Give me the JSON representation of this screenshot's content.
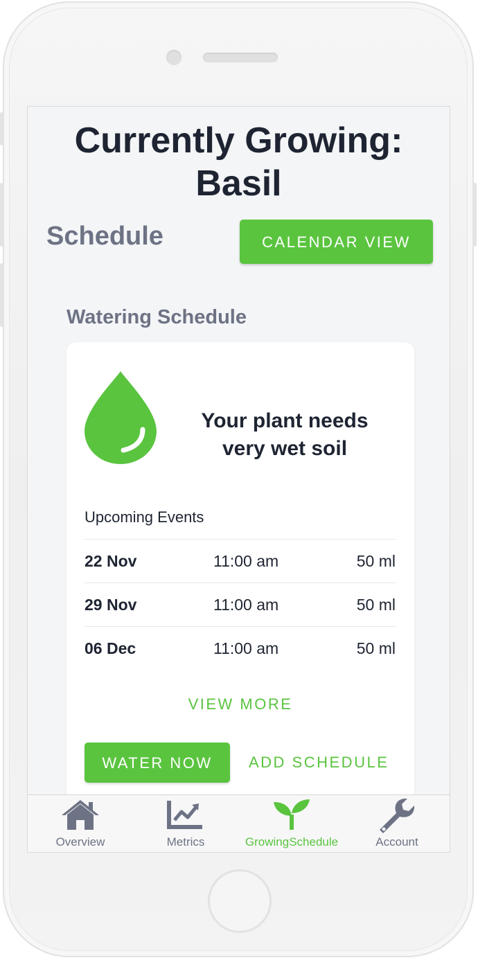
{
  "header": {
    "title_line1": "Currently Growing:",
    "title_line2": "Basil"
  },
  "schedule": {
    "section_title": "Schedule",
    "calendar_button": "CALENDAR VIEW"
  },
  "watering": {
    "title": "Watering Schedule",
    "icon": "water-drop-icon",
    "need_line1": "Your plant needs",
    "need_line2": "very wet soil",
    "events_heading": "Upcoming Events",
    "events": [
      {
        "date": "22 Nov",
        "time": "11:00 am",
        "amount": "50 ml"
      },
      {
        "date": "29 Nov",
        "time": "11:00 am",
        "amount": "50 ml"
      },
      {
        "date": "06 Dec",
        "time": "11:00 am",
        "amount": "50 ml"
      }
    ],
    "view_more": "VIEW MORE",
    "water_now": "WATER NOW",
    "add_schedule": "ADD SCHEDULE"
  },
  "tabs": [
    {
      "label": "Overview",
      "icon": "home-icon"
    },
    {
      "label": "Metrics",
      "icon": "chart-icon"
    },
    {
      "label": "GrowingSchedule",
      "icon": "sprout-icon",
      "active": true
    },
    {
      "label": "Account",
      "icon": "wrench-icon"
    }
  ],
  "colors": {
    "accent": "#5ac43f",
    "text_dark": "#1e2432",
    "text_muted": "#6d7384",
    "screen_bg": "#f4f5f7"
  }
}
